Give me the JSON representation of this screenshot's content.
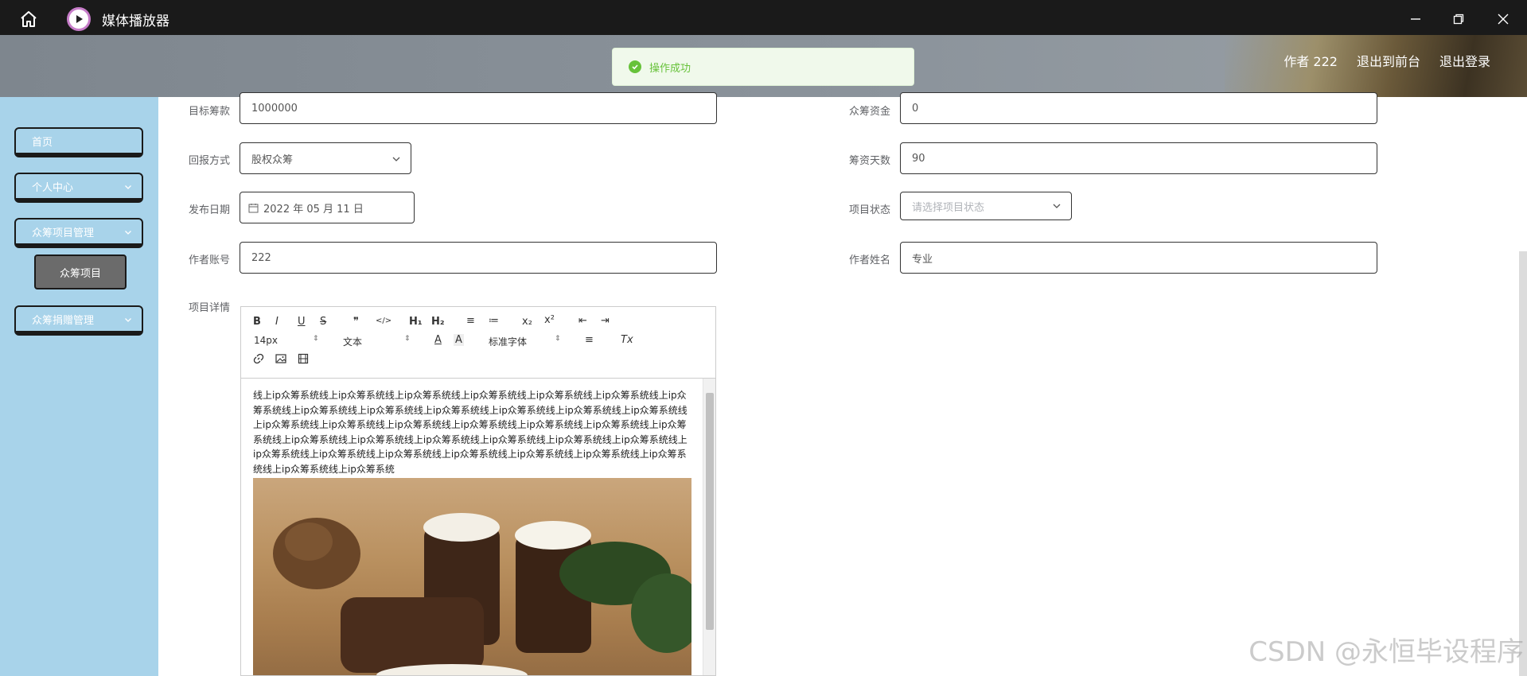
{
  "window": {
    "title": "媒体播放器"
  },
  "header": {
    "user_label": "作者 222",
    "front_link": "退出到前台",
    "logout_link": "退出登录"
  },
  "toast": {
    "message": "操作成功"
  },
  "sidebar": {
    "items": [
      {
        "label": "首页"
      },
      {
        "label": "个人中心"
      },
      {
        "label": "众筹项目管理"
      },
      {
        "label": "众筹捐赠管理"
      }
    ],
    "sub_item": "众筹项目"
  },
  "form": {
    "target_label": "目标筹款",
    "target_value": "1000000",
    "funds_label": "众筹资金",
    "funds_value": "0",
    "return_label": "回报方式",
    "return_value": "股权众筹",
    "days_label": "筹资天数",
    "days_value": "90",
    "date_label": "发布日期",
    "date_value": "2022 年 05 月 11 日",
    "status_label": "项目状态",
    "status_placeholder": "请选择项目状态",
    "account_label": "作者账号",
    "account_value": "222",
    "name_label": "作者姓名",
    "name_value": "专业",
    "detail_label": "项目详情"
  },
  "editor": {
    "toolbar": {
      "bold": "B",
      "italic": "I",
      "underline": "U",
      "strike": "S",
      "quote": "❞",
      "code": "</>",
      "h1": "H₁",
      "h2": "H₂",
      "ordered_list": "≡",
      "bullet_list": "≔",
      "subscript": "x₂",
      "superscript": "x²",
      "outdent": "⇤",
      "indent": "⇥",
      "font_size": "14px",
      "format": "文本",
      "font_family": "标准字体",
      "color": "A",
      "background": "A",
      "align": "≡",
      "clear": "Tx"
    },
    "content_text": "线上ip众筹系统线上ip众筹系统线上ip众筹系统线上ip众筹系统线上ip众筹系统线上ip众筹系统线上ip众筹系统线上ip众筹系统线上ip众筹系统线上ip众筹系统线上ip众筹系统线上ip众筹系统线上ip众筹系统线上ip众筹系统线上ip众筹系统线上ip众筹系统线上ip众筹系统线上ip众筹系统线上ip众筹系统线上ip众筹系统线上ip众筹系统线上ip众筹系统线上ip众筹系统线上ip众筹系统线上ip众筹系统线上ip众筹系统线上ip众筹系统线上ip众筹系统线上ip众筹系统线上ip众筹系统线上ip众筹系统线上ip众筹系统线上ip众筹系统线上ip众筹系统线上ip众筹系统"
  },
  "watermark": "CSDN @永恒毕设程序"
}
